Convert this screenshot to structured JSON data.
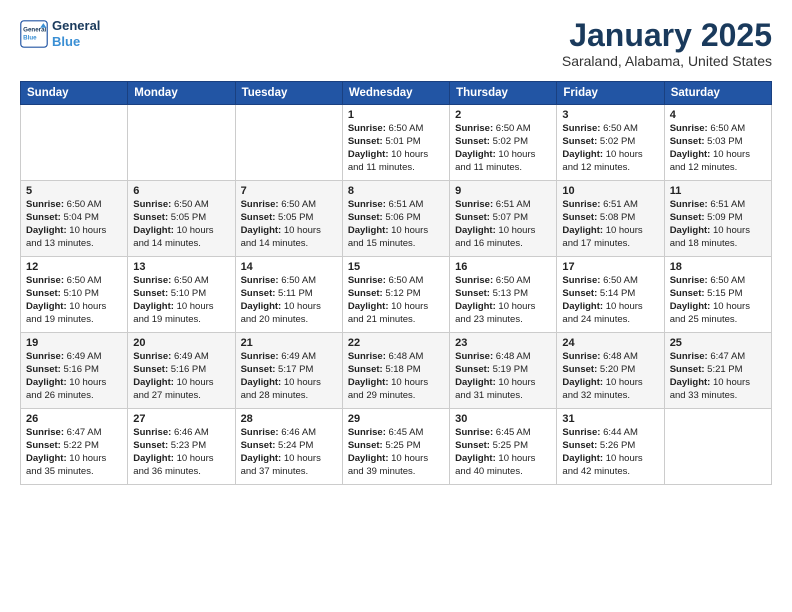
{
  "header": {
    "logo_line1": "General",
    "logo_line2": "Blue",
    "title": "January 2025",
    "subtitle": "Saraland, Alabama, United States"
  },
  "days_of_week": [
    "Sunday",
    "Monday",
    "Tuesday",
    "Wednesday",
    "Thursday",
    "Friday",
    "Saturday"
  ],
  "weeks": [
    [
      {
        "day": "",
        "content": ""
      },
      {
        "day": "",
        "content": ""
      },
      {
        "day": "",
        "content": ""
      },
      {
        "day": "1",
        "content": "Sunrise: 6:50 AM\nSunset: 5:01 PM\nDaylight: 10 hours\nand 11 minutes."
      },
      {
        "day": "2",
        "content": "Sunrise: 6:50 AM\nSunset: 5:02 PM\nDaylight: 10 hours\nand 11 minutes."
      },
      {
        "day": "3",
        "content": "Sunrise: 6:50 AM\nSunset: 5:02 PM\nDaylight: 10 hours\nand 12 minutes."
      },
      {
        "day": "4",
        "content": "Sunrise: 6:50 AM\nSunset: 5:03 PM\nDaylight: 10 hours\nand 12 minutes."
      }
    ],
    [
      {
        "day": "5",
        "content": "Sunrise: 6:50 AM\nSunset: 5:04 PM\nDaylight: 10 hours\nand 13 minutes."
      },
      {
        "day": "6",
        "content": "Sunrise: 6:50 AM\nSunset: 5:05 PM\nDaylight: 10 hours\nand 14 minutes."
      },
      {
        "day": "7",
        "content": "Sunrise: 6:50 AM\nSunset: 5:05 PM\nDaylight: 10 hours\nand 14 minutes."
      },
      {
        "day": "8",
        "content": "Sunrise: 6:51 AM\nSunset: 5:06 PM\nDaylight: 10 hours\nand 15 minutes."
      },
      {
        "day": "9",
        "content": "Sunrise: 6:51 AM\nSunset: 5:07 PM\nDaylight: 10 hours\nand 16 minutes."
      },
      {
        "day": "10",
        "content": "Sunrise: 6:51 AM\nSunset: 5:08 PM\nDaylight: 10 hours\nand 17 minutes."
      },
      {
        "day": "11",
        "content": "Sunrise: 6:51 AM\nSunset: 5:09 PM\nDaylight: 10 hours\nand 18 minutes."
      }
    ],
    [
      {
        "day": "12",
        "content": "Sunrise: 6:50 AM\nSunset: 5:10 PM\nDaylight: 10 hours\nand 19 minutes."
      },
      {
        "day": "13",
        "content": "Sunrise: 6:50 AM\nSunset: 5:10 PM\nDaylight: 10 hours\nand 19 minutes."
      },
      {
        "day": "14",
        "content": "Sunrise: 6:50 AM\nSunset: 5:11 PM\nDaylight: 10 hours\nand 20 minutes."
      },
      {
        "day": "15",
        "content": "Sunrise: 6:50 AM\nSunset: 5:12 PM\nDaylight: 10 hours\nand 21 minutes."
      },
      {
        "day": "16",
        "content": "Sunrise: 6:50 AM\nSunset: 5:13 PM\nDaylight: 10 hours\nand 23 minutes."
      },
      {
        "day": "17",
        "content": "Sunrise: 6:50 AM\nSunset: 5:14 PM\nDaylight: 10 hours\nand 24 minutes."
      },
      {
        "day": "18",
        "content": "Sunrise: 6:50 AM\nSunset: 5:15 PM\nDaylight: 10 hours\nand 25 minutes."
      }
    ],
    [
      {
        "day": "19",
        "content": "Sunrise: 6:49 AM\nSunset: 5:16 PM\nDaylight: 10 hours\nand 26 minutes."
      },
      {
        "day": "20",
        "content": "Sunrise: 6:49 AM\nSunset: 5:16 PM\nDaylight: 10 hours\nand 27 minutes."
      },
      {
        "day": "21",
        "content": "Sunrise: 6:49 AM\nSunset: 5:17 PM\nDaylight: 10 hours\nand 28 minutes."
      },
      {
        "day": "22",
        "content": "Sunrise: 6:48 AM\nSunset: 5:18 PM\nDaylight: 10 hours\nand 29 minutes."
      },
      {
        "day": "23",
        "content": "Sunrise: 6:48 AM\nSunset: 5:19 PM\nDaylight: 10 hours\nand 31 minutes."
      },
      {
        "day": "24",
        "content": "Sunrise: 6:48 AM\nSunset: 5:20 PM\nDaylight: 10 hours\nand 32 minutes."
      },
      {
        "day": "25",
        "content": "Sunrise: 6:47 AM\nSunset: 5:21 PM\nDaylight: 10 hours\nand 33 minutes."
      }
    ],
    [
      {
        "day": "26",
        "content": "Sunrise: 6:47 AM\nSunset: 5:22 PM\nDaylight: 10 hours\nand 35 minutes."
      },
      {
        "day": "27",
        "content": "Sunrise: 6:46 AM\nSunset: 5:23 PM\nDaylight: 10 hours\nand 36 minutes."
      },
      {
        "day": "28",
        "content": "Sunrise: 6:46 AM\nSunset: 5:24 PM\nDaylight: 10 hours\nand 37 minutes."
      },
      {
        "day": "29",
        "content": "Sunrise: 6:45 AM\nSunset: 5:25 PM\nDaylight: 10 hours\nand 39 minutes."
      },
      {
        "day": "30",
        "content": "Sunrise: 6:45 AM\nSunset: 5:25 PM\nDaylight: 10 hours\nand 40 minutes."
      },
      {
        "day": "31",
        "content": "Sunrise: 6:44 AM\nSunset: 5:26 PM\nDaylight: 10 hours\nand 42 minutes."
      },
      {
        "day": "",
        "content": ""
      }
    ]
  ]
}
